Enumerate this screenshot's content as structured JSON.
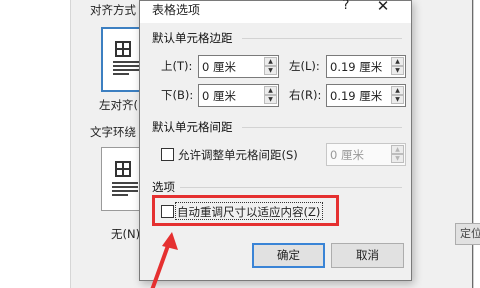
{
  "background": {
    "align_label": "对齐方式",
    "align_option": "左对齐(L)",
    "wrap_label": "文字环绕",
    "wrap_option": "无(N)",
    "position_button": "定位(P)..."
  },
  "dialog": {
    "title": "表格选项",
    "help": "?",
    "close": "✕",
    "margins_section": "默认单元格边距",
    "top_label": "上(T):",
    "top_value": "0 厘米",
    "bottom_label": "下(B):",
    "bottom_value": "0 厘米",
    "left_label": "左(L):",
    "left_value": "0.19 厘米",
    "right_label": "右(R):",
    "right_value": "0.19 厘米",
    "spacing_section": "默认单元格间距",
    "allow_spacing_label": "允许调整单元格间距(S)",
    "spacing_value": "0 厘米",
    "options_section": "选项",
    "autofit_label": "自动重调尺寸以适应内容(Z)",
    "ok": "确定",
    "cancel": "取消"
  },
  "annotation_color": "#e53030",
  "accent_color": "#3a84d6"
}
